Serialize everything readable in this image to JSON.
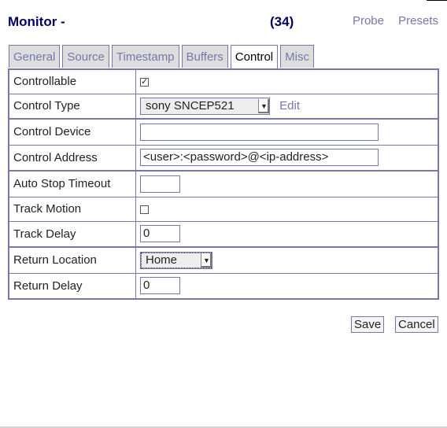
{
  "header": {
    "title": "Monitor -",
    "count": "(34)",
    "links": [
      "Probe",
      "Presets"
    ]
  },
  "tabs": [
    {
      "label": "General",
      "active": false
    },
    {
      "label": "Source",
      "active": false
    },
    {
      "label": "Timestamp",
      "active": false
    },
    {
      "label": "Buffers",
      "active": false
    },
    {
      "label": "Control",
      "active": true
    },
    {
      "label": "Misc",
      "active": false
    }
  ],
  "form": {
    "controllable": {
      "label": "Controllable",
      "checked": true,
      "mark": "✓"
    },
    "control_type": {
      "label": "Control Type",
      "value": "sony SNCEP521",
      "edit_label": "Edit"
    },
    "control_device": {
      "label": "Control Device",
      "value": ""
    },
    "control_address": {
      "label": "Control Address",
      "value": "<user>:<password>@<ip-address>"
    },
    "auto_stop_timeout": {
      "label": "Auto Stop Timeout",
      "value": ""
    },
    "track_motion": {
      "label": "Track Motion",
      "checked": false
    },
    "track_delay": {
      "label": "Track Delay",
      "value": "0"
    },
    "return_location": {
      "label": "Return Location",
      "value": "Home"
    },
    "return_delay": {
      "label": "Return Delay",
      "value": "0"
    }
  },
  "buttons": {
    "save": "Save",
    "cancel": "Cancel"
  }
}
